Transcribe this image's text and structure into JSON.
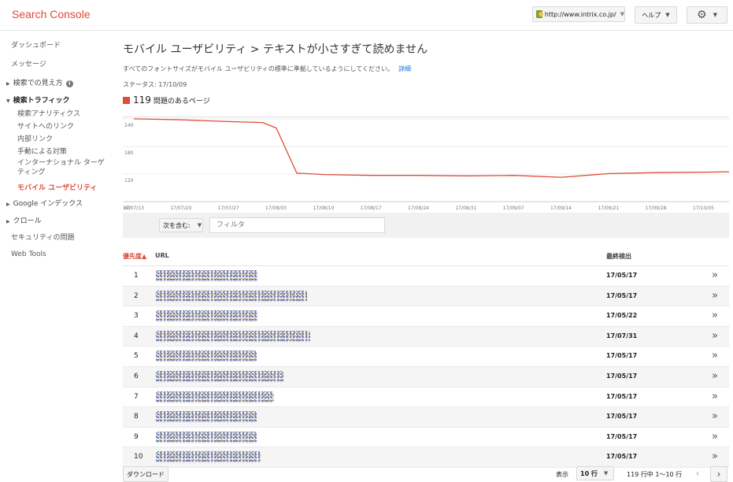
{
  "app": {
    "brand": "Search Console"
  },
  "header": {
    "site_url": "http://www.intrix.co.jp/",
    "help_label": "ヘルプ",
    "settings_icon": "gear-icon"
  },
  "sidebar": {
    "items": [
      {
        "label": "ダッシュボード"
      },
      {
        "label": "メッセージ"
      },
      {
        "label": "検索での見え方"
      },
      {
        "label": "検索トラフィック"
      },
      {
        "label": "検索アナリティクス"
      },
      {
        "label": "サイトへのリンク"
      },
      {
        "label": "内部リンク"
      },
      {
        "label": "手動による対策"
      },
      {
        "label": "インターナショナル ターゲティング"
      },
      {
        "label": "モバイル ユーザビリティ"
      },
      {
        "label": "Google インデックス"
      },
      {
        "label": "クロール"
      },
      {
        "label": "セキュリティの問題"
      },
      {
        "label": "Web Tools"
      }
    ]
  },
  "main": {
    "title": "モバイル ユーザビリティ > テキストが小さすぎて読めません",
    "description": "すべてのフォントサイズがモバイル ユーザビリティの標準に準拠しているようにしてください。",
    "detail_link": "詳細",
    "status": "ステータス: 17/10/09",
    "count_value": "119",
    "count_label": "問題のあるページ",
    "accent_color": "#dd4b39"
  },
  "chart_data": {
    "type": "line",
    "x": [
      "17/07/13",
      "17/07/20",
      "17/07/27",
      "17/08/03",
      "17/08/10",
      "17/08/17",
      "17/08/24",
      "17/08/31",
      "17/09/07",
      "17/09/14",
      "17/09/21",
      "17/09/28",
      "17/10/05"
    ],
    "yticks": [
      240,
      180,
      120,
      60
    ],
    "ylim": [
      60,
      245
    ],
    "series": [
      {
        "color": "#dd4b39",
        "points": [
          [
            "17/07/13",
            240
          ],
          [
            "17/07/20",
            238
          ],
          [
            "17/07/27",
            234
          ],
          [
            "17/08/01",
            232
          ],
          [
            "17/08/03",
            220
          ],
          [
            "17/08/06",
            122
          ],
          [
            "17/08/10",
            119
          ],
          [
            "17/08/17",
            117
          ],
          [
            "17/08/24",
            117
          ],
          [
            "17/08/31",
            116
          ],
          [
            "17/09/07",
            117
          ],
          [
            "17/09/14",
            113
          ],
          [
            "17/09/21",
            121
          ],
          [
            "17/09/28",
            123
          ],
          [
            "17/10/05",
            124
          ],
          [
            "17/10/09",
            125
          ]
        ]
      }
    ]
  },
  "filter": {
    "dropdown_label": "次を含む:",
    "placeholder": "フィルタ"
  },
  "table": {
    "headers": {
      "priority": "優先度▲",
      "url": "URL",
      "last_detected": "最終検出"
    },
    "rows": [
      {
        "rank": "1",
        "date": "17/05/17"
      },
      {
        "rank": "2",
        "date": "17/05/17"
      },
      {
        "rank": "3",
        "date": "17/05/22"
      },
      {
        "rank": "4",
        "date": "17/07/31"
      },
      {
        "rank": "5",
        "date": "17/05/17"
      },
      {
        "rank": "6",
        "date": "17/05/17"
      },
      {
        "rank": "7",
        "date": "17/05/17"
      },
      {
        "rank": "8",
        "date": "17/05/17"
      },
      {
        "rank": "9",
        "date": "17/05/17"
      },
      {
        "rank": "10",
        "date": "17/05/17"
      }
    ],
    "go_glyph": "»"
  },
  "footer": {
    "download_label": "ダウンロード",
    "show_label": "表示",
    "rows_per_page": "10 行",
    "range_text": "119 行中 1〜10 行",
    "prev": "‹",
    "next": "›"
  }
}
